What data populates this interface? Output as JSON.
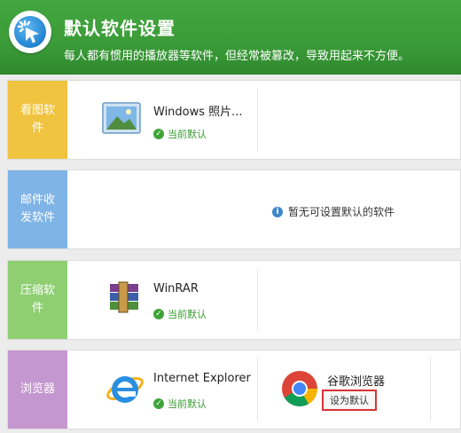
{
  "header": {
    "title": "默认软件设置",
    "subtitle": "每人都有惯用的播放器等软件，但经常被篡改，导致用起来不方便。"
  },
  "rows": [
    {
      "label": "看图软件",
      "color": "#f0c341",
      "apps": [
        {
          "name": "Windows 照片...",
          "status": "当前默认",
          "icon": "windows-photo-icon"
        }
      ]
    },
    {
      "label": "邮件收发软件",
      "color": "#7fb4e6",
      "message": "暂无可设置默认的软件",
      "apps": []
    },
    {
      "label": "压缩软件",
      "color": "#8fcf72",
      "apps": [
        {
          "name": "WinRAR",
          "status": "当前默认",
          "icon": "winrar-icon"
        }
      ]
    },
    {
      "label": "浏览器",
      "color": "#c597d0",
      "apps": [
        {
          "name": "Internet Explorer",
          "status": "当前默认",
          "icon": "internet-explorer-icon"
        },
        {
          "name": "谷歌浏览器",
          "button": "设为默认",
          "icon": "chrome-icon"
        }
      ]
    }
  ]
}
